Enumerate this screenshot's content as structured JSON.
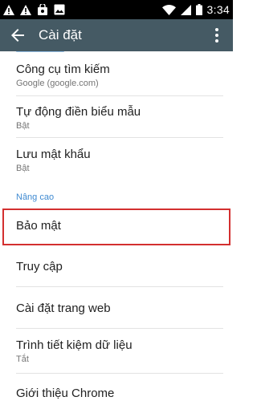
{
  "status_bar": {
    "time": "3:34",
    "icons": [
      "warning-icon",
      "warning-icon",
      "shopping-bag-icon",
      "image-icon",
      "wifi-icon",
      "signal-icon",
      "battery-icon"
    ]
  },
  "app_bar": {
    "title": "Cài đặt",
    "background": "#455a64",
    "back_icon": "arrow-left-icon",
    "more_icon": "more-vert-icon"
  },
  "settings": {
    "items": [
      {
        "label": "Công cụ tìm kiếm",
        "sub": "Google (google.com)"
      },
      {
        "label": "Tự động điền biểu mẫu",
        "sub": "Bật"
      },
      {
        "label": "Lưu mật khẩu",
        "sub": "Bật"
      }
    ],
    "advanced_header": "Nâng cao",
    "advanced_items": [
      {
        "label": "Bảo mật"
      },
      {
        "label": "Truy cập"
      },
      {
        "label": "Cài đặt trang web"
      },
      {
        "label": "Trình tiết kiệm dữ liệu",
        "sub": "Tắt"
      },
      {
        "label": "Giới thiệu Chrome"
      }
    ]
  },
  "highlight_color": "#d32f2f",
  "accent_color": "#3f8ad1"
}
